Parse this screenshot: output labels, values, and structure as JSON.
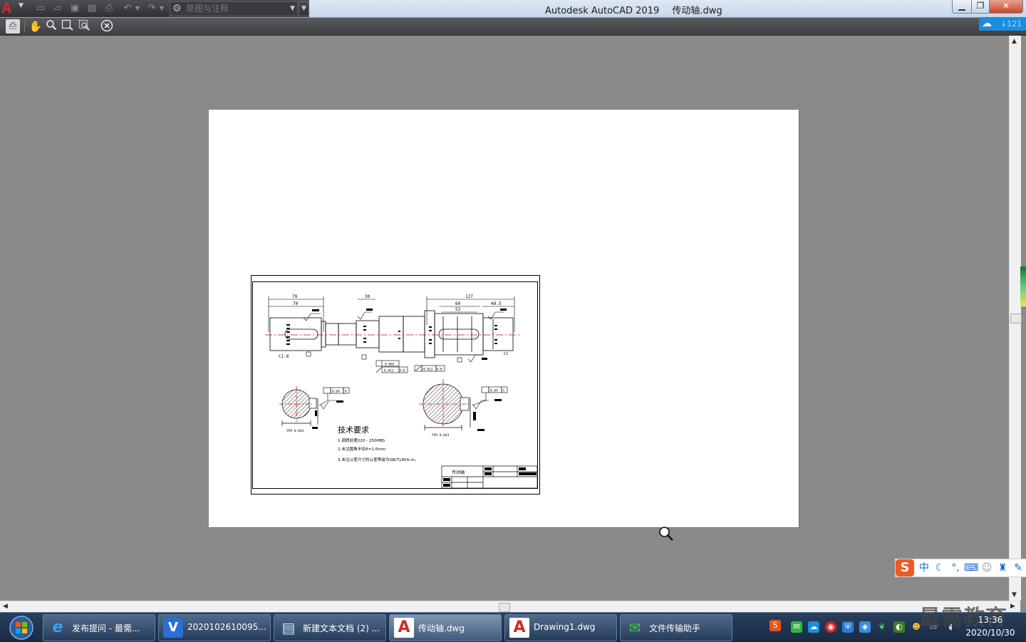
{
  "titlebar": {
    "app_name": "Autodesk AutoCAD 2019",
    "document": "传动轴.dwg",
    "workspace": "草图与注释",
    "logo": "A"
  },
  "cloud": {
    "count": "121"
  },
  "drawing": {
    "dims": {
      "d79": "79",
      "d70": "70",
      "d30": "30",
      "d127": "127",
      "d60": "60",
      "d53": "53",
      "d49_5": "49.5"
    },
    "chamfer_left": "C1.6",
    "tolerances": {
      "t1": "0.002",
      "t2": "0.012",
      "t2ref": "A-B",
      "t3": "0.012",
      "t3ref": "A-B",
      "t4": "0.04",
      "t4ref": "A",
      "t5": "0.04",
      "t5ref": "C"
    },
    "tech_title": "技术要求",
    "tech_lines": [
      "1.调质处理220 - 250HBS",
      "2.未注圆角半径R=1.6mm",
      "3.未注公差尺寸的公差等级为GB/T1804-m。"
    ],
    "title_block_name": "传动轴"
  },
  "ime": {
    "logo": "S",
    "lang": "中"
  },
  "taskbar": {
    "tasks": [
      {
        "label": "发布提问 - 最需..."
      },
      {
        "label": "2020102610095..."
      },
      {
        "label": "新建文本文档 (2) ..."
      },
      {
        "label": "传动轴.dwg"
      },
      {
        "label": "Drawing1.dwg"
      },
      {
        "label": "文件传输助手"
      }
    ],
    "clock_time": "13:36",
    "clock_date": "2020/10/30"
  },
  "watermark": "最需教育",
  "colors": {
    "accent": "#1a8de0",
    "autocad_red": "#e0262e",
    "centerline": "#e00000"
  }
}
